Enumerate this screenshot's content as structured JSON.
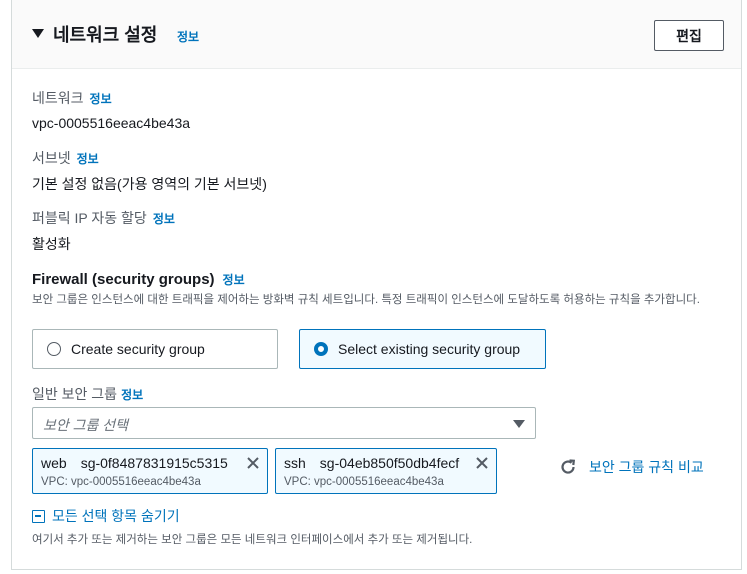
{
  "header": {
    "title": "네트워크 설정",
    "info": "정보",
    "edit_label": "편집"
  },
  "network": {
    "label": "네트워크",
    "info": "정보",
    "value": "vpc-0005516eeac4be43a"
  },
  "subnet": {
    "label": "서브넷",
    "info": "정보",
    "value": "기본 설정 없음(가용 영역의 기본 서브넷)"
  },
  "public_ip": {
    "label": "퍼블릭 IP 자동 할당",
    "info": "정보",
    "value": "활성화"
  },
  "firewall": {
    "title": "Firewall (security groups)",
    "info": "정보",
    "description": "보안 그룹은 인스턴스에 대한 트래픽을 제어하는 방화벽 규칙 세트입니다. 특정 트래픽이 인스턴스에 도달하도록 허용하는 규칙을 추가합니다.",
    "options": [
      {
        "label": "Create security group",
        "selected": false
      },
      {
        "label": "Select existing security group",
        "selected": true
      }
    ]
  },
  "security_groups": {
    "label": "일반 보안 그룹",
    "info": "정보",
    "placeholder": "보안 그룹 선택",
    "tokens": [
      {
        "name": "web",
        "id": "sg-0f8487831915c5315",
        "vpc": "VPC: vpc-0005516eeac4be43a"
      },
      {
        "name": "ssh",
        "id": "sg-04eb850f50db4fecf",
        "vpc": "VPC: vpc-0005516eeac4be43a"
      }
    ],
    "compare_label": "보안 그룹 규칙 비교",
    "hide_label": "모든 선택 항목 숨기기",
    "note": "여기서 추가 또는 제거하는 보안 그룹은 모든 네트워크 인터페이스에서 추가 또는 제거됩니다."
  },
  "colors": {
    "link": "#0073bb",
    "text": "#16191f",
    "muted": "#545b64",
    "border": "#aab7b8",
    "selected_bg": "#f1faff"
  }
}
